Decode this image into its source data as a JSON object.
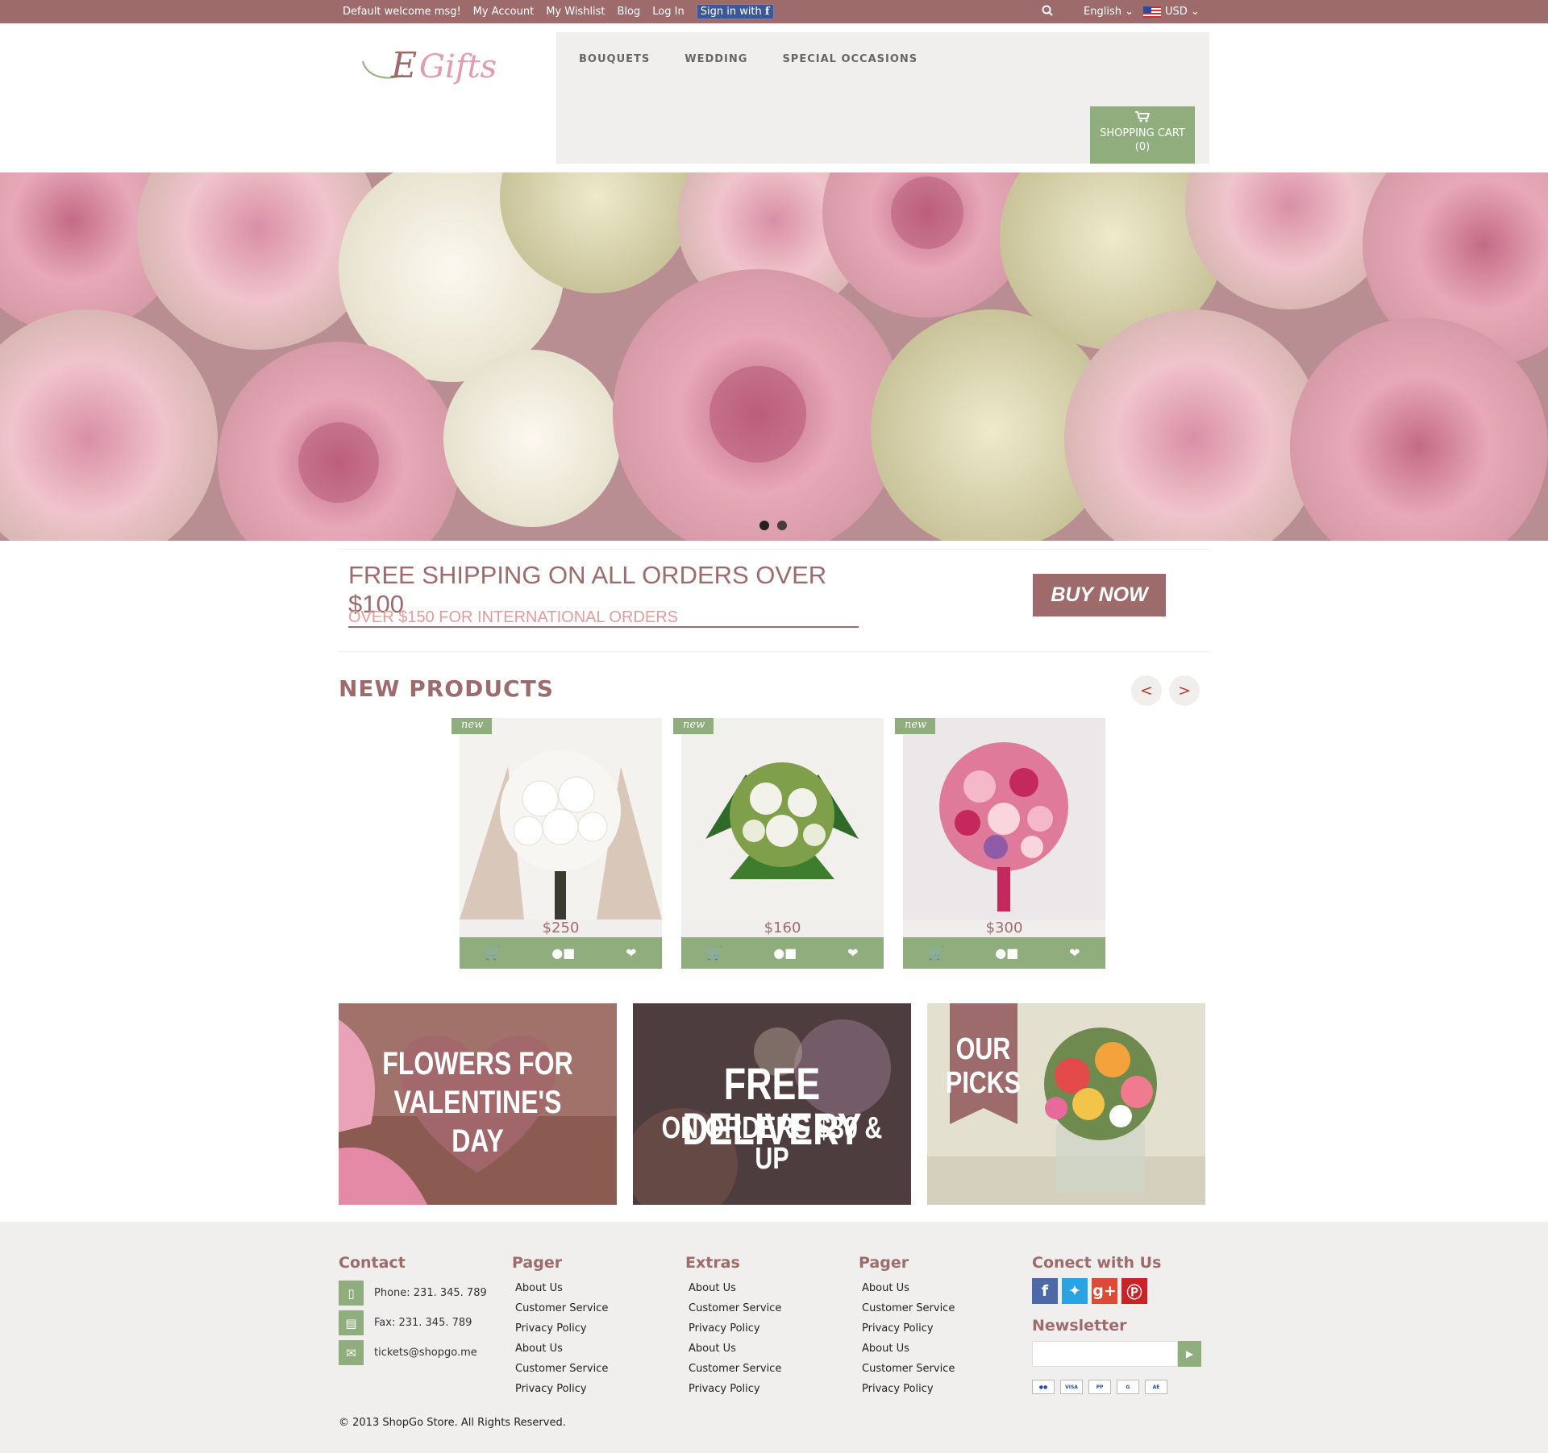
{
  "topbar": {
    "welcome": "Default welcome msg!",
    "my_account": "My Account",
    "my_wishlist": "My Wishlist",
    "blog": "Blog",
    "log_in": "Log In",
    "sign_in_fb": "Sign in with",
    "fb_letter": "f",
    "language": "English",
    "currency": "USD"
  },
  "header": {
    "logo_text": "Gifts",
    "logo_initial": "E",
    "menu": [
      "BOUQUETS",
      "WEDDING",
      "SPECIAL OCCASIONS"
    ],
    "cart_label": "SHOPPING CART",
    "cart_count": "(0)"
  },
  "banner": {
    "line1": "FREE SHIPPING ON ALL ORDERS OVER $100",
    "line2": "OVER $150 FOR INTERNATIONAL ORDERS",
    "cta": "BUY NOW"
  },
  "new_products": {
    "title": "NEW PRODUCTS",
    "prev": "<",
    "next": ">",
    "tag": "new",
    "items": [
      {
        "price": "$250"
      },
      {
        "price": "$160"
      },
      {
        "price": "$300"
      }
    ]
  },
  "promos": {
    "valentine": [
      "FLOWERS FOR",
      "VALENTINE'S",
      "DAY"
    ],
    "delivery": [
      "FREE DELIVERY",
      "ON ORDERS $30 & UP"
    ],
    "picks": [
      "OUR",
      "PICKS"
    ]
  },
  "footer": {
    "contact_title": "Contact",
    "phone": "Phone: 231. 345. 789",
    "fax": "Fax: 231. 345. 789",
    "email": "tickets@shopgo.me",
    "col2_title": "Pager",
    "col3_title": "Extras",
    "col4_title": "Pager",
    "links": [
      "About Us",
      "Customer Service",
      "Privacy Policy",
      "About Us",
      "Customer Service",
      "Privacy Policy"
    ],
    "connect_title": "Conect with Us",
    "newsletter_title": "Newsletter",
    "copyright": "© 2013 ShopGo Store. All Rights Reserved."
  },
  "colors": {
    "brand": "#9e6b6d",
    "accent_green": "#8fad7d",
    "panel_bg": "#f0efed"
  }
}
